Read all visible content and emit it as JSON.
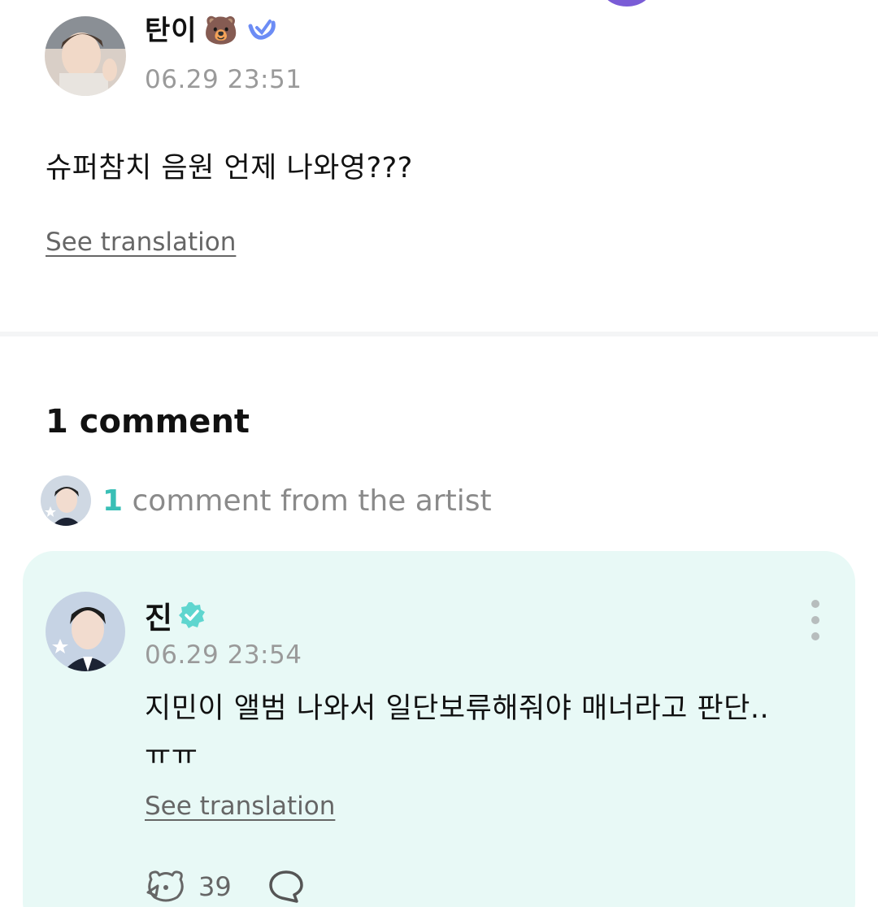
{
  "post": {
    "author": "탄이",
    "author_emoji": "🐻",
    "timestamp": "06.29 23:51",
    "text": "슈퍼참치 음원 언제 나와영???",
    "see_translation": "See translation"
  },
  "comments": {
    "title": "1 comment",
    "artist_count": "1",
    "artist_label": "comment from the artist"
  },
  "comment": {
    "author": "진",
    "timestamp": "06.29 23:54",
    "text_line1": "지민이 앨범 나와서 일단보류해줘야 매너라고 판단..",
    "text_line2": "ㅠㅠ",
    "see_translation": "See translation",
    "like_count": "39"
  },
  "colors": {
    "accent_teal": "#39bfb6",
    "card_bg": "#e8f9f6",
    "verified_blue": "#6c8cf5",
    "artist_badge": "#5fd6cf"
  }
}
